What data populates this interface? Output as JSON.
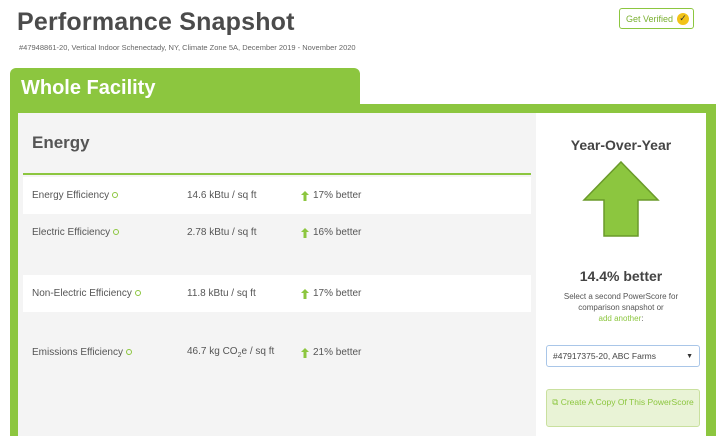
{
  "header": {
    "title": "Performance Snapshot",
    "subtitle": "#47948861-20, Vertical Indoor Schenectady, NY, Climate Zone 5A, December 2019 - November 2020",
    "verify_label": "Get Verified"
  },
  "tab": {
    "label": "Whole Facility"
  },
  "energy": {
    "title": "Energy",
    "rows": [
      {
        "name": "Energy Efficiency",
        "value": "14.6 kBtu / sq ft",
        "change": "17% better"
      },
      {
        "name": "Electric Efficiency",
        "value": "2.78 kBtu / sq ft",
        "change": "16% better"
      },
      {
        "name": "Non-Electric Efficiency",
        "value": "11.8 kBtu / sq ft",
        "change": "17% better"
      },
      {
        "name": "Emissions Efficiency",
        "value_prefix": "46.7 kg CO",
        "value_sub": "2",
        "value_suffix": "e / sq ft",
        "change": "21% better"
      }
    ]
  },
  "yoy": {
    "title": "Year-Over-Year",
    "value": "14.4% better",
    "description": "Select a second PowerScore for comparison snapshot or",
    "add_link": "add another",
    "add_link_suffix": ":",
    "select_value": "#47917375-20, ABC Farms",
    "copy_button": "Create A Copy Of This PowerScore"
  },
  "colors": {
    "brand_green": "#8cc63f",
    "arrow_fill": "#8cc63f",
    "badge_yellow": "#f2c318"
  },
  "icons": {
    "verify": "check-badge-icon",
    "info": "info-icon",
    "change": "up-arrow-icon",
    "yoy": "big-up-arrow-icon",
    "copy": "copy-icon",
    "select": "caret-down-icon"
  }
}
